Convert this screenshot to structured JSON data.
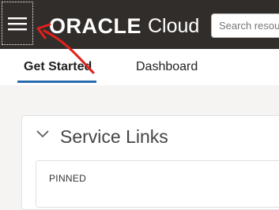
{
  "header": {
    "menu_icon": "hamburger-menu-icon",
    "brand": "ORACLE",
    "product": "Cloud",
    "search_placeholder": "Search resources"
  },
  "tabs": [
    {
      "label": "Get Started",
      "active": true
    },
    {
      "label": "Dashboard",
      "active": false
    }
  ],
  "service_links": {
    "collapse_icon": "chevron-down-icon",
    "title": "Service Links",
    "pinned_label": "PINNED"
  },
  "annotation": {
    "type": "red-arrow",
    "color": "#e0201b",
    "points_to": "hamburger-menu-button"
  },
  "colors": {
    "header_bg": "#312d2a",
    "tab_underline": "#2b6cb0",
    "page_bg": "#f5f4f2"
  }
}
